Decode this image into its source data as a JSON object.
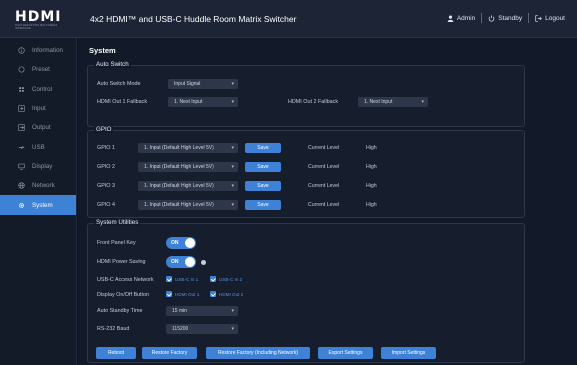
{
  "header": {
    "logo": "HDMI",
    "logo_sub": "HIGH-DEFINITION MULTIMEDIA INTERFACE",
    "title": "4x2 HDMI™ and USB-C Huddle Room Matrix Switcher",
    "user": "Admin",
    "standby": "Standby",
    "logout": "Logout"
  },
  "sidebar": {
    "items": [
      {
        "label": "Information",
        "icon": "info-icon"
      },
      {
        "label": "Preset",
        "icon": "preset-icon"
      },
      {
        "label": "Control",
        "icon": "control-icon"
      },
      {
        "label": "Input",
        "icon": "input-icon"
      },
      {
        "label": "Output",
        "icon": "output-icon"
      },
      {
        "label": "USB",
        "icon": "usb-icon"
      },
      {
        "label": "Display",
        "icon": "display-icon"
      },
      {
        "label": "Network",
        "icon": "network-icon"
      },
      {
        "label": "System",
        "icon": "gear-icon",
        "active": true
      }
    ]
  },
  "page": {
    "title": "System"
  },
  "auto_switch": {
    "title": "Auto Switch",
    "mode_label": "Auto Switch Mode",
    "mode_value": "Input Signal",
    "out1_label": "HDMI Out 1 Fallback",
    "out1_value": "1. Next Input",
    "out2_label": "HDMI Out 2 Fallback",
    "out2_value": "1. Next Input"
  },
  "gpio": {
    "title": "GPIO",
    "rows": [
      {
        "label": "GPIO 1",
        "value": "1. Input (Default High Level 5V)",
        "save": "Save",
        "level_label": "Current Level",
        "level": "High"
      },
      {
        "label": "GPIO 2",
        "value": "1. Input (Default High Level 5V)",
        "save": "Save",
        "level_label": "Current Level",
        "level": "High"
      },
      {
        "label": "GPIO 3",
        "value": "1. Input (Default High Level 5V)",
        "save": "Save",
        "level_label": "Current Level",
        "level": "High"
      },
      {
        "label": "GPIO 4",
        "value": "1. Input (Default High Level 5V)",
        "save": "Save",
        "level_label": "Current Level",
        "level": "High"
      }
    ]
  },
  "utilities": {
    "title": "System Utilities",
    "front_panel_label": "Front Panel Key",
    "front_panel_value": "ON",
    "hdmi_power_label": "HDMI Power Saving",
    "hdmi_power_value": "ON",
    "usbc_label": "USB-C Access Network",
    "usbc_options": [
      "USB-C In 1",
      "USB-C In 2"
    ],
    "display_label": "Display On/Off Button",
    "display_options": [
      "HDMI Out 1",
      "HDMI Out 2"
    ],
    "standby_label": "Auto Standby Time",
    "standby_value": "15 min",
    "baud_label": "RS-232 Baud",
    "baud_value": "115200",
    "buttons": [
      "Reboot",
      "Restore Factory",
      "Restore Factory (Including Network)",
      "Export Settings",
      "Import Settings"
    ]
  },
  "colors": {
    "accent": "#3d82d6",
    "background": "#121929",
    "sidebar": "#131a28"
  }
}
